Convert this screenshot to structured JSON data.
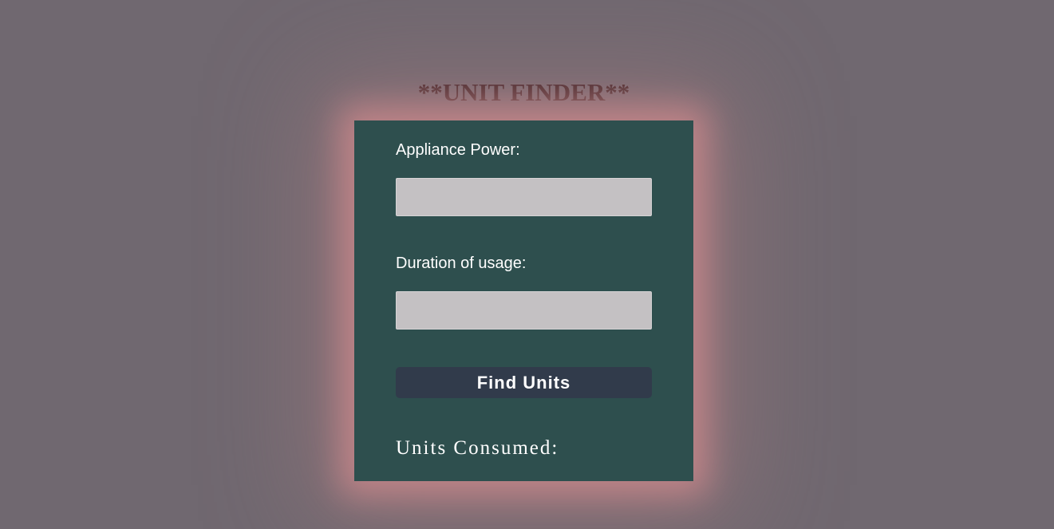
{
  "header": {
    "title": "**UNIT FINDER**"
  },
  "form": {
    "power_label": "Appliance Power:",
    "power_value": "",
    "duration_label": "Duration of usage:",
    "duration_value": "",
    "submit_label": "Find Units",
    "result_label": "Units Consumed:"
  },
  "colors": {
    "page_background": "#706870",
    "card_background": "#2e4f4e",
    "card_glow": "#c08488",
    "title_text": "#3e2326",
    "input_background": "#c4c1c3",
    "button_background": "#313b4b"
  }
}
